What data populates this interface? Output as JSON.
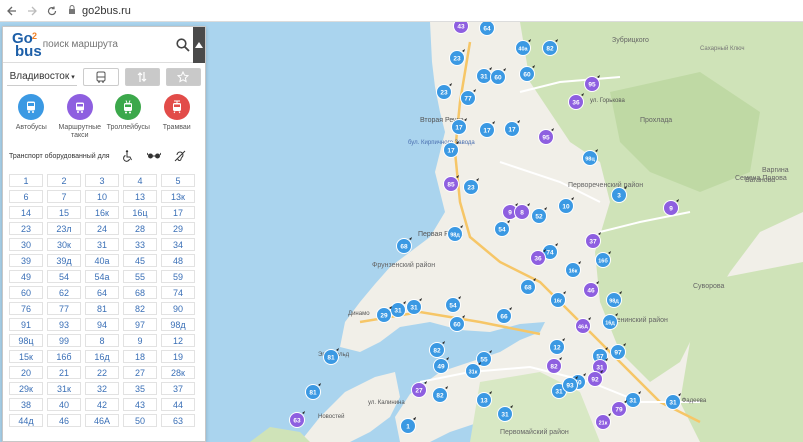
{
  "browser": {
    "back_icon": "arrow-left-icon",
    "forward_icon": "arrow-right-icon",
    "reload_icon": "reload-icon",
    "lock_icon": "lock-icon",
    "url": "go2bus.ru"
  },
  "panel": {
    "logo": {
      "go": "Go",
      "two": "2",
      "bus": "bus"
    },
    "search_placeholder": "поиск маршрута",
    "city": "Владивосток",
    "transport_types": [
      {
        "label": "Автобусы",
        "color": "#3b99e3",
        "icon": "bus-icon"
      },
      {
        "label": "Маршрутные такси",
        "color": "#8e5fe0",
        "icon": "minibus-icon"
      },
      {
        "label": "Троллейбусы",
        "color": "#3ca84b",
        "icon": "trolleybus-icon"
      },
      {
        "label": "Трамваи",
        "color": "#e24c49",
        "icon": "tram-icon"
      }
    ],
    "equipped_label": "Транспорт оборудованный для",
    "routes": [
      "1",
      "2",
      "3",
      "4",
      "5",
      "6",
      "7",
      "10",
      "13",
      "13к",
      "14",
      "15",
      "16к",
      "16ц",
      "17",
      "23",
      "23л",
      "24",
      "28",
      "29",
      "30",
      "30к",
      "31",
      "33",
      "34",
      "39",
      "39д",
      "40а",
      "45",
      "48",
      "49",
      "54",
      "54а",
      "55",
      "59",
      "60",
      "62",
      "64",
      "68",
      "74",
      "76",
      "77",
      "81",
      "82",
      "90",
      "91",
      "93",
      "94",
      "97",
      "98д",
      "98ц",
      "99",
      "8",
      "9",
      "12",
      "15к",
      "16б",
      "16д",
      "18",
      "19",
      "20",
      "21",
      "22",
      "27",
      "28к",
      "29к",
      "31к",
      "32",
      "35",
      "37",
      "38",
      "40",
      "42",
      "43",
      "44",
      "44д",
      "46",
      "46А",
      "50",
      "63"
    ]
  },
  "map": {
    "labels": [
      "Зубрицкого",
      "Прохлада",
      "Варгина",
      "Сахарный Ключ",
      "ул. Горькова",
      "Ваганова",
      "Вторая Речка",
      "бул. Кирпичного Завода",
      "Первореченский район",
      "Первая Речка",
      "Фрунзенский район",
      "Ленинский район",
      "Суворова",
      "Семена Полова",
      "Первомайский район",
      "Динамо",
      "Эгершельд",
      "ул. Калинина",
      "ул. Фадеева",
      "Новостей"
    ],
    "markers": [
      {
        "label": "43",
        "type": "minibus"
      },
      {
        "label": "64",
        "type": "bus"
      },
      {
        "label": "40а",
        "type": "bus"
      },
      {
        "label": "82",
        "type": "bus"
      },
      {
        "label": "23",
        "type": "bus"
      },
      {
        "label": "60",
        "type": "bus"
      },
      {
        "label": "31",
        "type": "bus"
      },
      {
        "label": "60",
        "type": "bus"
      },
      {
        "label": "95",
        "type": "minibus"
      },
      {
        "label": "36",
        "type": "minibus"
      },
      {
        "label": "23",
        "type": "bus"
      },
      {
        "label": "77",
        "type": "bus"
      },
      {
        "label": "17",
        "type": "bus"
      },
      {
        "label": "17",
        "type": "bus"
      },
      {
        "label": "17",
        "type": "bus"
      },
      {
        "label": "95",
        "type": "minibus"
      },
      {
        "label": "17",
        "type": "bus"
      },
      {
        "label": "98ц",
        "type": "bus"
      },
      {
        "label": "85",
        "type": "minibus"
      },
      {
        "label": "23",
        "type": "bus"
      },
      {
        "label": "3",
        "type": "bus"
      },
      {
        "label": "10",
        "type": "bus"
      },
      {
        "label": "9",
        "type": "minibus"
      },
      {
        "label": "9",
        "type": "minibus"
      },
      {
        "label": "8",
        "type": "minibus"
      },
      {
        "label": "54",
        "type": "bus"
      },
      {
        "label": "52",
        "type": "bus"
      },
      {
        "label": "37",
        "type": "minibus"
      },
      {
        "label": "68",
        "type": "bus"
      },
      {
        "label": "98д",
        "type": "bus"
      },
      {
        "label": "74",
        "type": "bus"
      },
      {
        "label": "36",
        "type": "minibus"
      },
      {
        "label": "16к",
        "type": "bus"
      },
      {
        "label": "16б",
        "type": "bus"
      },
      {
        "label": "46",
        "type": "minibus"
      },
      {
        "label": "54",
        "type": "bus"
      },
      {
        "label": "68",
        "type": "bus"
      },
      {
        "label": "31",
        "type": "bus"
      },
      {
        "label": "98д",
        "type": "bus"
      },
      {
        "label": "31",
        "type": "bus"
      },
      {
        "label": "29",
        "type": "bus"
      },
      {
        "label": "60",
        "type": "bus"
      },
      {
        "label": "66",
        "type": "bus"
      },
      {
        "label": "16д",
        "type": "bus"
      },
      {
        "label": "46А",
        "type": "minibus"
      },
      {
        "label": "12",
        "type": "bus"
      },
      {
        "label": "16г",
        "type": "bus"
      },
      {
        "label": "97",
        "type": "bus"
      },
      {
        "label": "57",
        "type": "bus"
      },
      {
        "label": "60",
        "type": "bus"
      },
      {
        "label": "81",
        "type": "bus"
      },
      {
        "label": "82",
        "type": "bus"
      },
      {
        "label": "55",
        "type": "bus"
      },
      {
        "label": "49",
        "type": "bus"
      },
      {
        "label": "31",
        "type": "minibus"
      },
      {
        "label": "31",
        "type": "bus"
      },
      {
        "label": "82",
        "type": "minibus"
      },
      {
        "label": "31к",
        "type": "bus"
      },
      {
        "label": "93",
        "type": "bus"
      },
      {
        "label": "92",
        "type": "minibus"
      },
      {
        "label": "81",
        "type": "bus"
      },
      {
        "label": "27",
        "type": "minibus"
      },
      {
        "label": "82",
        "type": "bus"
      },
      {
        "label": "13",
        "type": "bus"
      },
      {
        "label": "63",
        "type": "minibus"
      },
      {
        "label": "31",
        "type": "bus"
      },
      {
        "label": "4",
        "type": "bus"
      },
      {
        "label": "31",
        "type": "bus"
      },
      {
        "label": "79",
        "type": "minibus"
      },
      {
        "label": "31",
        "type": "bus"
      },
      {
        "label": "21к",
        "type": "minibus"
      },
      {
        "label": "1",
        "type": "bus"
      }
    ]
  }
}
